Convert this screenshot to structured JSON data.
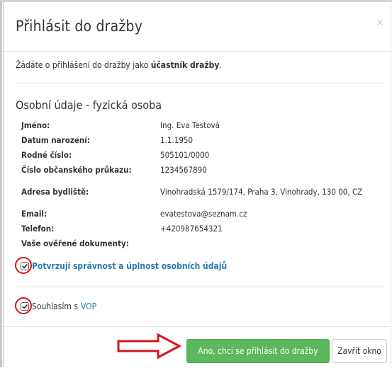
{
  "dialog": {
    "title": "Přihlásit do dražby",
    "close_symbol": "×"
  },
  "intro": {
    "prefix": "Žádáte o přihlášení do dražby jako ",
    "emphasis": "účastník dražby",
    "suffix": "."
  },
  "personal": {
    "section_title": "Osobní údaje - fyzická osoba",
    "rows": [
      {
        "label": "Jméno:",
        "value": "Ing. Eva Testová"
      },
      {
        "label": "Datum narození:",
        "value": "1.1.1950"
      },
      {
        "label": "Rodné číslo:",
        "value": "505101/0000"
      },
      {
        "label": "Číslo občanského průkazu:",
        "value": "1234567890"
      },
      {
        "label": "Adresa bydliště:",
        "value": "Vinohradská 1579/174, Praha 3, Vinohrady, 130 00, CZ"
      },
      {
        "label": "Email:",
        "value": "evatestova@seznam.cz"
      },
      {
        "label": "Telefon:",
        "value": "+420987654321"
      },
      {
        "label": "Vaše ověřené dokumenty:",
        "value": ""
      }
    ]
  },
  "confirm": {
    "label": "Potvrzuji správnost a úplnost osobních údajů",
    "checked": true
  },
  "terms": {
    "label": "Souhlasím s",
    "link": "VOP",
    "checked": true
  },
  "footer": {
    "submit_label": "Ano, chci se přihlásit do dražby",
    "close_label": "Zavřít okno"
  },
  "colors": {
    "primary": "#5cb85c",
    "link": "#2a7ab0",
    "highlight": "#d9141b"
  },
  "icons": [
    "close-icon",
    "check-icon",
    "arrow-right-icon"
  ]
}
